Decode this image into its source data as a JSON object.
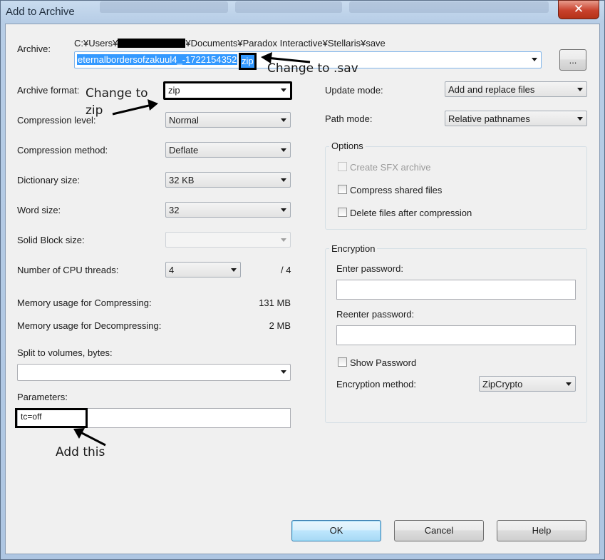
{
  "window": {
    "title": "Add to Archive",
    "close_glyph": "✕"
  },
  "archive": {
    "label": "Archive:",
    "path_start": "C:¥Users¥",
    "path_end": "¥Documents¥Paradox Interactive¥Stellaris¥save",
    "filename_main": "eternalbordersofzakuul4_-1722154352",
    "filename_ext": "zip",
    "browse_label": "..."
  },
  "left": {
    "archive_format": {
      "label": "Archive format:",
      "value": "zip"
    },
    "compression_level": {
      "label": "Compression level:",
      "value": "Normal"
    },
    "compression_method": {
      "label": "Compression method:",
      "value": "Deflate"
    },
    "dictionary_size": {
      "label": "Dictionary size:",
      "value": "32 KB"
    },
    "word_size": {
      "label": "Word size:",
      "value": "32"
    },
    "solid_block_size": {
      "label": "Solid Block size:",
      "value": ""
    },
    "cpu_threads": {
      "label": "Number of CPU threads:",
      "value": "4",
      "max": "/ 4"
    },
    "memory_compress": {
      "label": "Memory usage for Compressing:",
      "value": "131 MB"
    },
    "memory_decompress": {
      "label": "Memory usage for Decompressing:",
      "value": "2 MB"
    },
    "split_volumes": {
      "label": "Split to volumes, bytes:",
      "value": ""
    },
    "parameters": {
      "label": "Parameters:",
      "value": "tc=off"
    }
  },
  "right": {
    "update_mode": {
      "label": "Update mode:",
      "value": "Add and replace files"
    },
    "path_mode": {
      "label": "Path mode:",
      "value": "Relative pathnames"
    },
    "options": {
      "title": "Options",
      "create_sfx": "Create SFX archive",
      "compress_shared": "Compress shared files",
      "delete_after": "Delete files after compression"
    },
    "encryption": {
      "title": "Encryption",
      "enter_password": "Enter password:",
      "reenter_password": "Reenter password:",
      "show_password": "Show Password",
      "method_label": "Encryption method:",
      "method_value": "ZipCrypto"
    }
  },
  "buttons": {
    "ok": "OK",
    "cancel": "Cancel",
    "help": "Help"
  },
  "annotations": {
    "change_sav": "Change to .sav",
    "change_zip_line1": "Change to",
    "change_zip_line2": "zip",
    "add_this": "Add this"
  },
  "colors": {
    "selection": "#3399ff",
    "annotation": "#000000"
  }
}
